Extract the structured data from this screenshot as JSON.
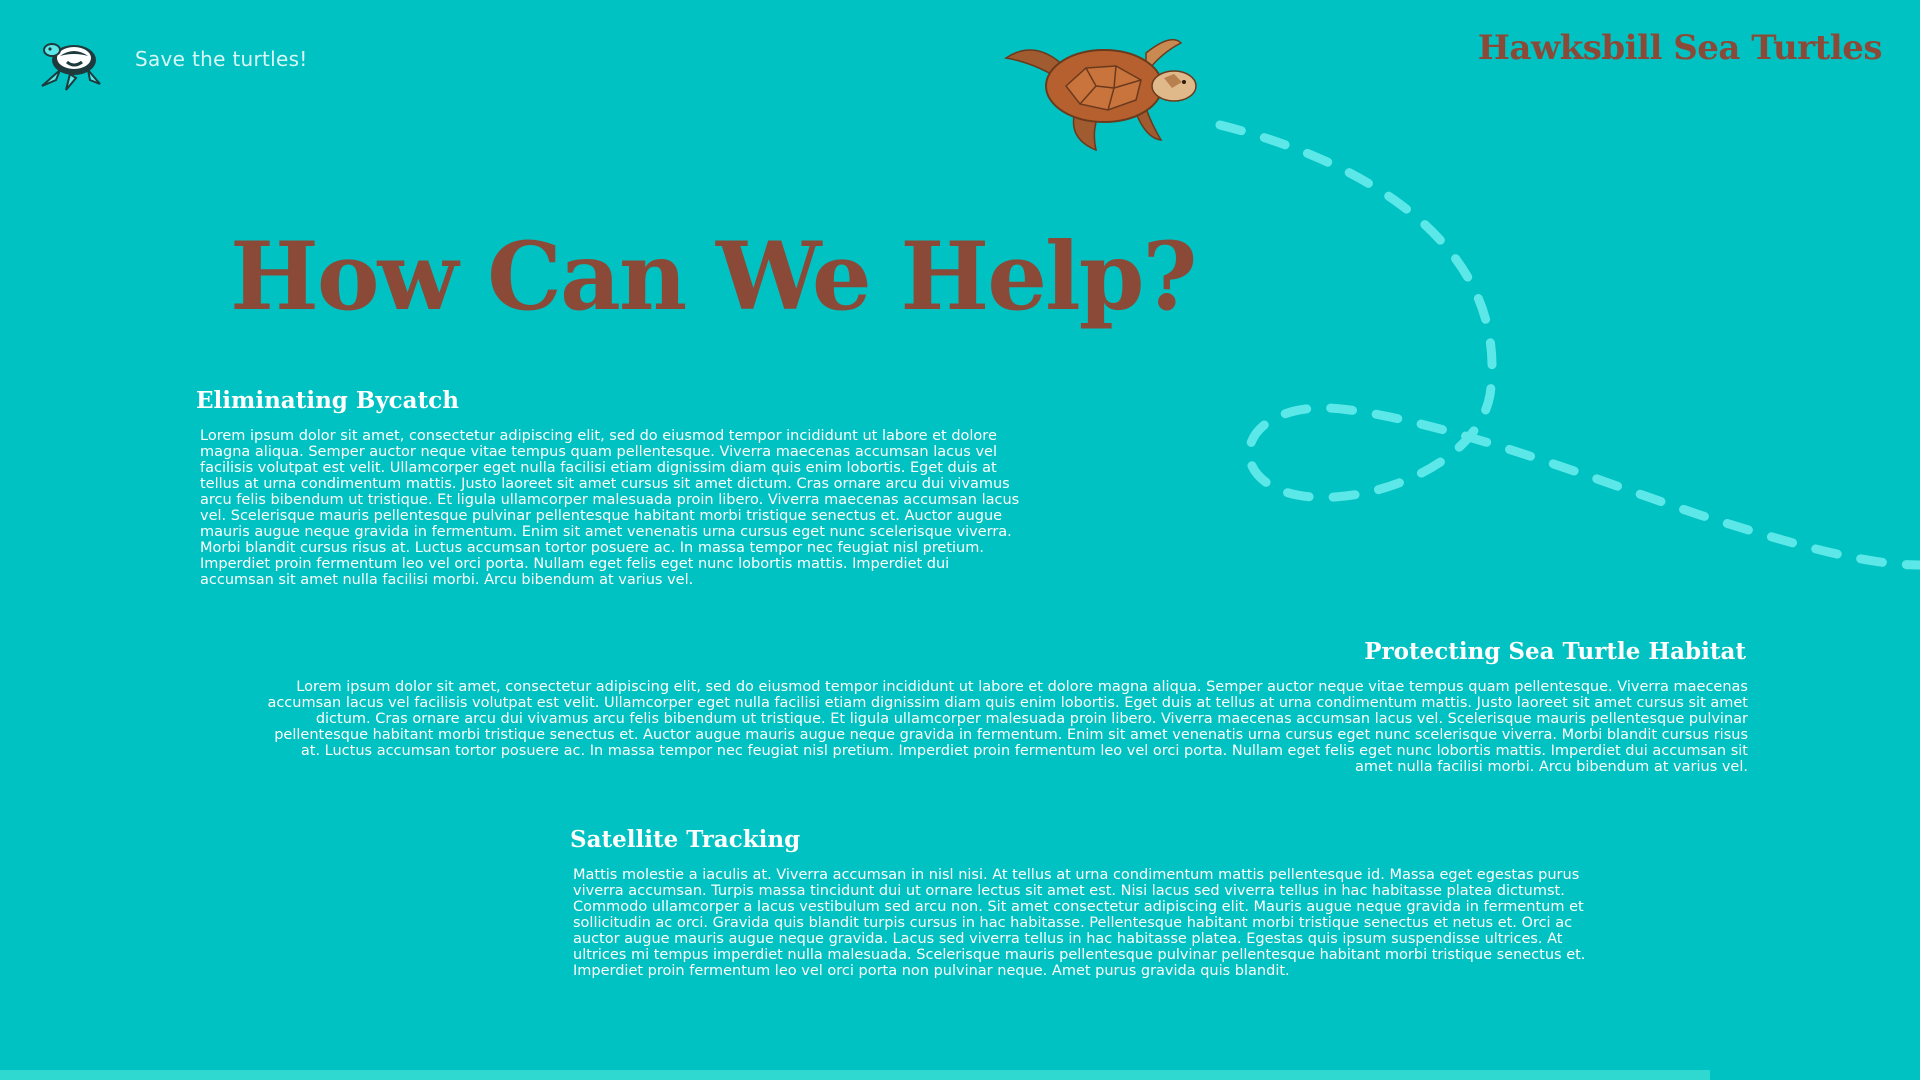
{
  "header": {
    "tagline": "Save the turtles!",
    "brand": "Hawksbill Sea Turtles"
  },
  "hero": {
    "title": "How Can We Help?"
  },
  "sections": [
    {
      "heading": "Eliminating Bycatch",
      "body": "Lorem ipsum dolor sit amet, consectetur adipiscing elit, sed do eiusmod tempor incididunt ut labore et dolore magna aliqua. Semper auctor neque vitae tempus quam pellentesque. Viverra maecenas accumsan lacus vel facilisis volutpat est velit. Ullamcorper eget nulla facilisi etiam dignissim diam quis enim lobortis. Eget duis at tellus at urna condimentum mattis. Justo laoreet sit amet cursus sit amet dictum. Cras ornare arcu dui vivamus arcu felis bibendum ut tristique. Et ligula ullamcorper malesuada proin libero. Viverra maecenas accumsan lacus vel. Scelerisque mauris pellentesque pulvinar pellentesque habitant morbi tristique senectus et. Auctor augue mauris augue neque gravida in fermentum. Enim sit amet venenatis urna cursus eget nunc scelerisque viverra. Morbi blandit cursus risus at. Luctus accumsan tortor posuere ac. In massa tempor nec feugiat nisl pretium. Imperdiet proin fermentum leo vel orci porta. Nullam eget felis eget nunc lobortis mattis. Imperdiet dui accumsan sit amet nulla facilisi morbi. Arcu bibendum at varius vel."
    },
    {
      "heading": "Protecting Sea Turtle Habitat",
      "body": "Lorem ipsum dolor sit amet, consectetur adipiscing elit, sed do eiusmod tempor incididunt ut labore et dolore magna aliqua. Semper auctor neque vitae tempus quam pellentesque. Viverra maecenas accumsan lacus vel facilisis volutpat est velit. Ullamcorper eget nulla facilisi etiam dignissim diam quis enim lobortis. Eget duis at tellus at urna condimentum mattis. Justo laoreet sit amet cursus sit amet dictum. Cras ornare arcu dui vivamus arcu felis bibendum ut tristique. Et ligula ullamcorper malesuada proin libero. Viverra maecenas accumsan lacus vel. Scelerisque mauris pellentesque pulvinar pellentesque habitant morbi tristique senectus et. Auctor augue mauris augue neque gravida in fermentum. Enim sit amet venenatis urna cursus eget nunc scelerisque viverra. Morbi blandit cursus risus at. Luctus accumsan tortor posuere ac. In massa tempor nec feugiat nisl pretium. Imperdiet proin fermentum leo vel orci porta. Nullam eget felis eget nunc lobortis mattis. Imperdiet dui accumsan sit amet nulla facilisi morbi. Arcu bibendum at varius vel."
    },
    {
      "heading": "Satellite Tracking",
      "body": "Mattis molestie a iaculis at. Viverra accumsan in nisl nisi. At tellus at urna condimentum mattis pellentesque id. Massa eget egestas purus viverra accumsan. Turpis massa tincidunt dui ut ornare lectus sit amet est. Nisi lacus sed viverra tellus in hac habitasse platea dictumst. Commodo ullamcorper a lacus vestibulum sed arcu non. Sit amet consectetur adipiscing elit. Mauris augue neque gravida in fermentum et sollicitudin ac orci. Gravida quis blandit turpis cursus in hac habitasse. Pellentesque habitant morbi tristique senectus et netus et. Orci ac auctor augue mauris augue neque gravida. Lacus sed viverra tellus in hac habitasse platea. Egestas quis ipsum suspendisse ultrices. At ultrices mi tempus imperdiet nulla malesuada. Scelerisque mauris pellentesque pulvinar pellentesque habitant morbi tristique senectus et. Imperdiet proin fermentum leo vel orci porta non pulvinar neque. Amet purus gravida quis blandit."
    }
  ],
  "icons": {
    "logo": "turtle-logo-icon",
    "illustration": "hawksbill-turtle-illustration-icon",
    "path": "dashed-swim-path-icon"
  },
  "colors": {
    "background": "#00c2c2",
    "accent": "#8b4a37",
    "path": "#5ce8e8",
    "bottom_bar": "#2fd9d0"
  }
}
